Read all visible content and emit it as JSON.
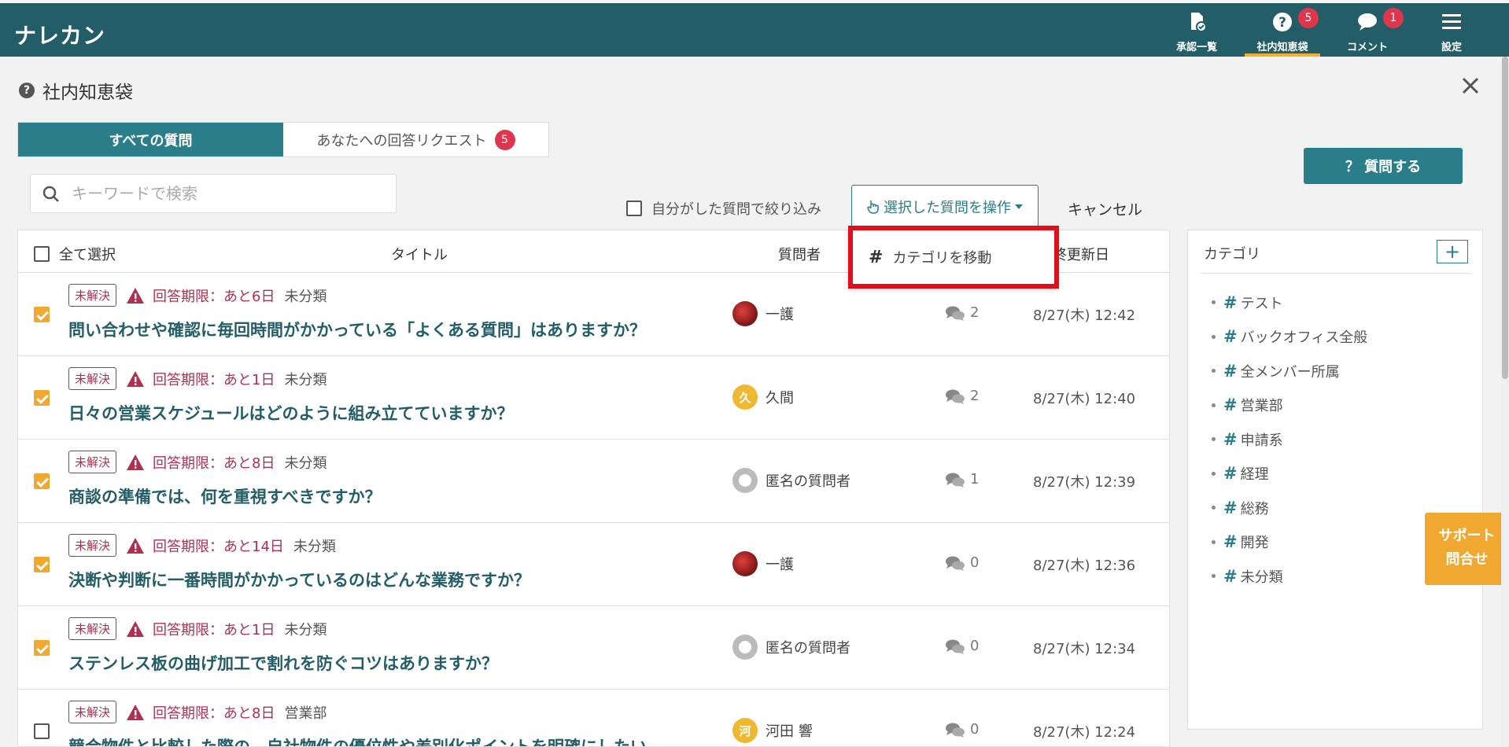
{
  "app": {
    "brand": "ナレカン"
  },
  "nav": [
    {
      "label": "承認一覧",
      "icon": "approval-doc-icon",
      "badge": ""
    },
    {
      "label": "社内知恵袋",
      "icon": "question-circle-icon",
      "badge": "5"
    },
    {
      "label": "コメント",
      "icon": "comment-icon",
      "badge": "1"
    },
    {
      "label": "設定",
      "icon": "hamburger-menu-icon",
      "badge": ""
    }
  ],
  "page": {
    "title": "社内知恵袋"
  },
  "tabs": {
    "all": "すべての質問",
    "requests": "あなたへの回答リクエスト",
    "requests_badge": "5"
  },
  "ask_button": "？ 質問する",
  "search": {
    "placeholder": "キーワードで検索"
  },
  "filter": {
    "own_only": "自分がした質問で絞り込み"
  },
  "actions": {
    "selected_ops": "選択した質問を操作",
    "cancel": "キャンセル",
    "menu": {
      "move_category": "カテゴリを移動"
    }
  },
  "table": {
    "headers": {
      "select_all": "全て選択",
      "title": "タイトル",
      "asker": "質問者",
      "updated": "終更新日"
    },
    "rows": [
      {
        "checked": true,
        "status": "未解決",
        "deadline": "回答期限：あと6日",
        "category": "未分類",
        "title": "問い合わせや確認に毎回時間がかかっている「よくある質問」はありますか？",
        "asker": "一護",
        "avatar": "photo",
        "avatar_letter": "",
        "comments": "2",
        "date": "8/27(木) 12:42"
      },
      {
        "checked": true,
        "status": "未解決",
        "deadline": "回答期限：あと1日",
        "category": "未分類",
        "title": "日々の営業スケジュールはどのように組み立てていますか？",
        "asker": "久間",
        "avatar": "letter",
        "avatar_letter": "久",
        "comments": "2",
        "date": "8/27(木) 12:40"
      },
      {
        "checked": true,
        "status": "未解決",
        "deadline": "回答期限：あと8日",
        "category": "未分類",
        "title": "商談の準備では、何を重視すべきですか？",
        "asker": "匿名の質問者",
        "avatar": "anon",
        "avatar_letter": "",
        "comments": "1",
        "date": "8/27(木) 12:39"
      },
      {
        "checked": true,
        "status": "未解決",
        "deadline": "回答期限：あと14日",
        "category": "未分類",
        "title": "決断や判断に一番時間がかかっているのはどんな業務ですか？",
        "asker": "一護",
        "avatar": "photo",
        "avatar_letter": "",
        "comments": "0",
        "date": "8/27(木) 12:36"
      },
      {
        "checked": true,
        "status": "未解決",
        "deadline": "回答期限：あと1日",
        "category": "未分類",
        "title": "ステンレス板の曲げ加工で割れを防ぐコツはありますか？",
        "asker": "匿名の質問者",
        "avatar": "anon",
        "avatar_letter": "",
        "comments": "0",
        "date": "8/27(木) 12:34"
      },
      {
        "checked": false,
        "status": "未解決",
        "deadline": "回答期限：あと8日",
        "category": "営業部",
        "title": "競合物件と比較した際の、自社物件の優位性や差別化ポイントを明確にしたい",
        "asker": "河田 響",
        "avatar": "letter",
        "avatar_letter": "河",
        "comments": "0",
        "date": "8/27(木) 12:24"
      }
    ]
  },
  "categories": {
    "title": "カテゴリ",
    "add": "+",
    "items": [
      "テスト",
      "バックオフィス全般",
      "全メンバー所属",
      "営業部",
      "申請系",
      "経理",
      "総務",
      "開発",
      "未分類"
    ]
  },
  "support": {
    "line1": "サポート",
    "line2": "問合せ"
  },
  "colors": {
    "header": "#235e68",
    "accent": "#2a7e8a",
    "alert": "#b03050",
    "highlight": "#e0101a",
    "checkbox": "#f0a830"
  }
}
